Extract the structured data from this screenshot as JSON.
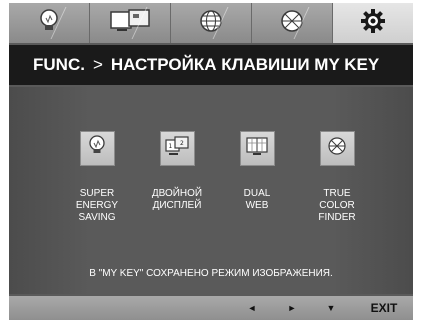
{
  "tabs": [
    {
      "icon": "bulb-icon",
      "active": false
    },
    {
      "icon": "dual-display-icon",
      "active": false
    },
    {
      "icon": "globe-icon",
      "active": false
    },
    {
      "icon": "color-wheel-icon",
      "active": false
    },
    {
      "icon": "gear-icon",
      "active": true
    }
  ],
  "title": {
    "prefix": "FUNC.",
    "separator": ">",
    "text": "НАСТРОЙКА КЛАВИШИ MY KEY"
  },
  "items": [
    {
      "icon": "bulb-icon",
      "label": "SUPER\nENERGY\nSAVING"
    },
    {
      "icon": "dual-display-icon",
      "label": "ДВОЙНОЙ\nДИСПЛЕЙ"
    },
    {
      "icon": "dual-web-icon",
      "label": "DUAL\nWEB"
    },
    {
      "icon": "color-wheel-icon",
      "label": "TRUE\nCOLOR\nFINDER"
    }
  ],
  "notice": "В \"MY KEY\" СОХРАНЕНО РЕЖИМ ИЗОБРАЖЕНИЯ.",
  "bottom": {
    "left_arrow": "◄",
    "right_arrow": "►",
    "down_arrow": "▼",
    "exit_label": "EXIT"
  }
}
